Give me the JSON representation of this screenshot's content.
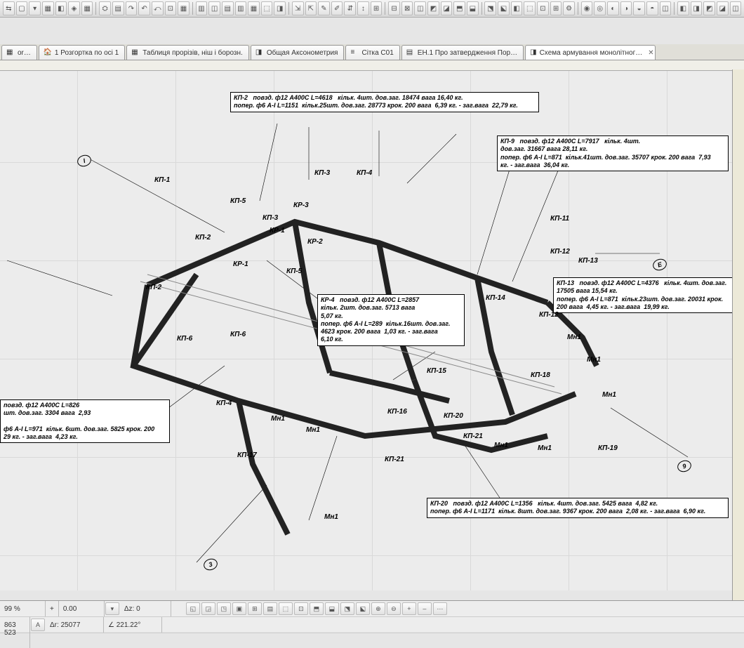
{
  "toolbar": {
    "buttons": [
      "⇆",
      "▢",
      "▾",
      "▦",
      "◧",
      "◈",
      "▦",
      "⛭",
      "▤",
      "↷",
      "↶",
      "⤺",
      "⊡",
      "▦",
      "▥",
      "◫",
      "▤",
      "▥",
      "▦",
      "⬚",
      "◨",
      "⇲",
      "⇱",
      "✎",
      "✐",
      "⇵",
      "↕",
      "⊞",
      "⊟",
      "⊠",
      "◫",
      "◩",
      "◪",
      "⬒",
      "⬓",
      "⬔",
      "⬕",
      "◧",
      "⬚",
      "⊡",
      "⊞",
      "⚙",
      "◉",
      "◎",
      "◐",
      "◑",
      "◒",
      "◓",
      "◫",
      "◧",
      "◨",
      "◩",
      "◪",
      "◫"
    ]
  },
  "tabs": {
    "items": [
      {
        "label": "or…",
        "icon": "▦"
      },
      {
        "label": "1 Розгортка по осі 1",
        "icon": "🏠"
      },
      {
        "label": "Таблиця прорізів, ніш і борозн.",
        "icon": "▦"
      },
      {
        "label": "Общая Аксонометрия",
        "icon": "◨"
      },
      {
        "label": "Сітка С01",
        "icon": "≡"
      },
      {
        "label": "ЕН.1 Про затвердження Пор…",
        "icon": "▤"
      },
      {
        "label": "Схема армування монолітног…",
        "icon": "◨",
        "active": true
      }
    ]
  },
  "callouts": {
    "kp2": "КП-2   повзд. ф12 А400С L=4618   кільк. 4шт. дов.заг. 18474 вага 16,40 кг.\nпопер. ф6 А-I L=1151  кільк.25шт. дов.заг. 28773 крок. 200 вага  6,39 кг. - заг.вага  22,79 кг.",
    "kp9": "КП-9   повзд. ф12 А400С L=7917   кільк. 4шт.\nдов.заг. 31667 вага 28,11 кг.\nпопер. ф6 А-I L=871  кільк.41шт. дов.заг. 35707 крок. 200 вага  7,93\nкг. - заг.вага  36,04 кг.",
    "kp13": "КП-13   повзд. ф12 А400С L=4376   кільк. 4шт. дов.заг.\n17505 вага 15,54 кг.\nпопер. ф6 А-I L=871  кільк.23шт. дов.заг. 20031 крок.\n200 вага  4,45 кг. - заг.вага  19,99 кг.",
    "kp4": "КР-4   повзд. ф12 А400С L=2857\nкільк. 2шт. дов.заг. 5713 вага\n5,07 кг.\nпопер. ф6 А-I L=289  кільк.16шт. дов.заг.\n4623 крок. 200 вага  1,03 кг. - заг.вага\n6,10 кг.",
    "kp6": "повзд. ф12 А400С L=826\nшт. дов.заг. 3304 вага  2,93\n\nф6 А-I L=971  кільк. 6шт. дов.заг. 5825 крок. 200\n29 кг. - заг.вага  4,23 кг.",
    "kp20": "КП-20   повзд. ф12 А400С L=1356   кільк. 4шт. дов.заг. 5425 вага  4,82 кг.\nпопер. ф6 А-I L=1171  кільк. 8шт. дов.заг. 9367 крок. 200 вага  2,08 кг. - заг.вага  6,90 кг."
  },
  "tags": {
    "kp1": "КП-1",
    "kp2b": "КП-2",
    "kp2c": "КП-2",
    "kp3": "КП-3",
    "kp4t": "КП-4",
    "kp4b": "КП-4",
    "kp5": "КП-5",
    "kp5b": "КП-5",
    "kp6": "КП-6",
    "kp6b": "КП-6",
    "kp11": "КП-11",
    "kp12": "КП-12",
    "kp12b": "КП-12",
    "kp13": "КП-13",
    "kp14": "КП-14",
    "kp15": "КП-15",
    "kp16": "КП-16",
    "kp17": "КП-17",
    "kp18": "КП-18",
    "kp19": "КП-19",
    "kp20": "КП-20",
    "kp21": "КП-21",
    "kp21b": "КП-21",
    "kr1": "КР-1",
    "kr1b": "КР-1",
    "kr2": "КР-2",
    "kr3": "КР-3",
    "kr3b": "КП-3",
    "mn1a": "Мн1",
    "mn1b": "Мн1",
    "mn1c": "Мн1",
    "mn1d": "Мн1",
    "mn1e": "Мн1",
    "mn1f": "Мн1",
    "mn1g": "Мн1",
    "mn1h": "Мн1"
  },
  "status": {
    "zoom": "99 %",
    "zoom_in": "+",
    "zoom_0": "0.00",
    "dz": "Δz: 0",
    "c1": "863",
    "c2": "523",
    "dr": "Δr: 25077",
    "angle": "∠ 221.22°"
  }
}
